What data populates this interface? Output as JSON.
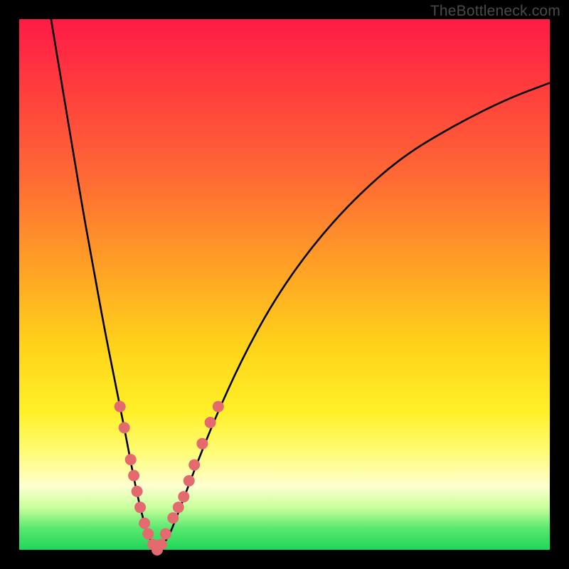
{
  "watermark": "TheBottleneck.com",
  "chart_data": {
    "type": "line",
    "title": "",
    "xlabel": "",
    "ylabel": "",
    "xlim": [
      0,
      100
    ],
    "ylim": [
      0,
      100
    ],
    "grid": false,
    "series": [
      {
        "name": "bottleneck-curve",
        "x": [
          6,
          8,
          10,
          12,
          14,
          16,
          18,
          20,
          21.5,
          23,
          24.5,
          26,
          28,
          30,
          33,
          37,
          42,
          48,
          55,
          63,
          72,
          82,
          92,
          100
        ],
        "values": [
          100,
          88,
          76,
          64,
          53,
          42,
          32,
          22,
          14,
          7,
          2,
          0,
          2,
          7,
          15,
          25,
          36,
          47,
          57,
          66,
          74,
          80,
          85,
          88
        ],
        "color": "#000000"
      }
    ],
    "markers": {
      "name": "highlight-dots",
      "color": "#e46a70",
      "radius": 8,
      "points": [
        {
          "x": 19.0,
          "y": 27
        },
        {
          "x": 19.8,
          "y": 23
        },
        {
          "x": 21.0,
          "y": 17
        },
        {
          "x": 21.6,
          "y": 14
        },
        {
          "x": 22.2,
          "y": 11
        },
        {
          "x": 22.8,
          "y": 8
        },
        {
          "x": 23.6,
          "y": 5
        },
        {
          "x": 24.3,
          "y": 3
        },
        {
          "x": 25.2,
          "y": 1
        },
        {
          "x": 26.0,
          "y": 0
        },
        {
          "x": 26.8,
          "y": 1
        },
        {
          "x": 27.6,
          "y": 3
        },
        {
          "x": 29.0,
          "y": 6
        },
        {
          "x": 30.0,
          "y": 8
        },
        {
          "x": 31.0,
          "y": 10
        },
        {
          "x": 32.0,
          "y": 13
        },
        {
          "x": 33.0,
          "y": 16
        },
        {
          "x": 34.5,
          "y": 20
        },
        {
          "x": 36.0,
          "y": 24
        },
        {
          "x": 37.5,
          "y": 27
        }
      ]
    },
    "gradient_stops": [
      {
        "pos": 0,
        "color": "#ff1a47"
      },
      {
        "pos": 12,
        "color": "#ff3a3e"
      },
      {
        "pos": 30,
        "color": "#ff6a34"
      },
      {
        "pos": 48,
        "color": "#ffa524"
      },
      {
        "pos": 62,
        "color": "#ffd41a"
      },
      {
        "pos": 74,
        "color": "#fff028"
      },
      {
        "pos": 82,
        "color": "#fffc7a"
      },
      {
        "pos": 88,
        "color": "#fdffd0"
      },
      {
        "pos": 92,
        "color": "#c9ff9d"
      },
      {
        "pos": 96,
        "color": "#57e86e"
      },
      {
        "pos": 100,
        "color": "#1fd65a"
      }
    ]
  }
}
